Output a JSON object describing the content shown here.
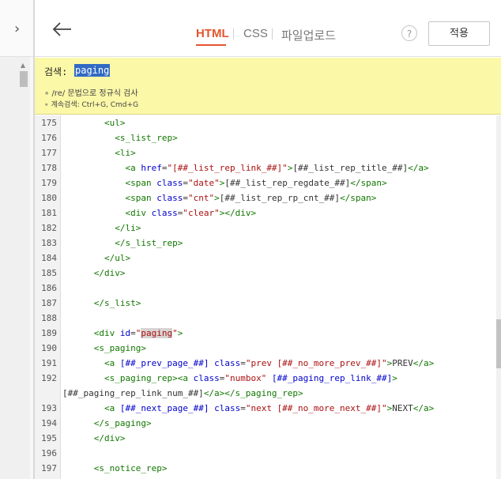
{
  "header": {
    "tabs": [
      {
        "label": "HTML"
      },
      {
        "label": "CSS"
      },
      {
        "label": "파일업로드"
      }
    ],
    "help_label": "?",
    "apply_label": "적용"
  },
  "search": {
    "label": "검색:",
    "query": "paging",
    "tip1": "∘ /re/ 문법으로 정규식 검사",
    "tip2": "∘ 계속검색: Ctrl+G, Cmd+G"
  },
  "code_lines": [
    {
      "n": "175",
      "html": "        <span class=\"tag\">&lt;ul&gt;</span>"
    },
    {
      "n": "176",
      "html": "          <span class=\"tag\">&lt;s_list_rep&gt;</span>"
    },
    {
      "n": "177",
      "html": "          <span class=\"tag\">&lt;li&gt;</span>"
    },
    {
      "n": "178",
      "html": "            <span class=\"tag\">&lt;a</span> <span class=\"attr\">href</span>=<span class=\"str\">\"[##_list_rep_link_##]\"</span><span class=\"tag\">&gt;</span>[##_list_rep_title_##]<span class=\"tag\">&lt;/a&gt;</span>"
    },
    {
      "n": "179",
      "html": "            <span class=\"tag\">&lt;span</span> <span class=\"attr\">class</span>=<span class=\"str\">\"date\"</span><span class=\"tag\">&gt;</span>[##_list_rep_regdate_##]<span class=\"tag\">&lt;/span&gt;</span>"
    },
    {
      "n": "180",
      "html": "            <span class=\"tag\">&lt;span</span> <span class=\"attr\">class</span>=<span class=\"str\">\"cnt\"</span><span class=\"tag\">&gt;</span>[##_list_rep_rp_cnt_##]<span class=\"tag\">&lt;/span&gt;</span>"
    },
    {
      "n": "181",
      "html": "            <span class=\"tag\">&lt;div</span> <span class=\"attr\">class</span>=<span class=\"str\">\"clear\"</span><span class=\"tag\">&gt;&lt;/div&gt;</span>"
    },
    {
      "n": "182",
      "html": "          <span class=\"tag\">&lt;/li&gt;</span>"
    },
    {
      "n": "183",
      "html": "          <span class=\"tag\">&lt;/s_list_rep&gt;</span>"
    },
    {
      "n": "184",
      "html": "        <span class=\"tag\">&lt;/ul&gt;</span>"
    },
    {
      "n": "185",
      "html": "      <span class=\"tag\">&lt;/div&gt;</span>"
    },
    {
      "n": "186",
      "html": ""
    },
    {
      "n": "187",
      "html": "      <span class=\"tag\">&lt;/s_list&gt;</span>"
    },
    {
      "n": "188",
      "html": ""
    },
    {
      "n": "189",
      "html": "      <span class=\"tag\">&lt;div</span> <span class=\"attr\">id</span>=<span class=\"str\">\"<span class=\"hl\">paging</span>\"</span><span class=\"tag\">&gt;</span>"
    },
    {
      "n": "190",
      "html": "      <span class=\"tag\">&lt;s_paging&gt;</span>"
    },
    {
      "n": "191",
      "html": "        <span class=\"tag\">&lt;a</span> <span class=\"attr\">[##_prev_page_##]</span> <span class=\"attr\">class</span>=<span class=\"str\">\"prev [##_no_more_prev_##]\"</span><span class=\"tag\">&gt;</span>PREV<span class=\"tag\">&lt;/a&gt;</span>"
    },
    {
      "n": "192",
      "html": "        <span class=\"tag\">&lt;s_paging_rep&gt;&lt;a</span> <span class=\"attr\">class</span>=<span class=\"str\">\"numbox\"</span> <span class=\"attr\">[##_paging_rep_link_##]</span><span class=\"tag\">&gt;</span>"
    },
    {
      "n": "",
      "html": "[##_paging_rep_link_num_##]<span class=\"tag\">&lt;/a&gt;&lt;/s_paging_rep&gt;</span>",
      "wrap": true
    },
    {
      "n": "193",
      "html": "        <span class=\"tag\">&lt;a</span> <span class=\"attr\">[##_next_page_##]</span> <span class=\"attr\">class</span>=<span class=\"str\">\"next [##_no_more_next_##]\"</span><span class=\"tag\">&gt;</span>NEXT<span class=\"tag\">&lt;/a&gt;</span>"
    },
    {
      "n": "194",
      "html": "      <span class=\"tag\">&lt;/s_paging&gt;</span>"
    },
    {
      "n": "195",
      "html": "      <span class=\"tag\">&lt;/div&gt;</span>"
    },
    {
      "n": "196",
      "html": ""
    },
    {
      "n": "197",
      "html": "      <span class=\"tag\">&lt;s_notice_rep&gt;</span>"
    }
  ],
  "colors": {
    "accent": "#e4542e",
    "search_bg": "#fbf8a8",
    "selection": "#316ac5"
  }
}
